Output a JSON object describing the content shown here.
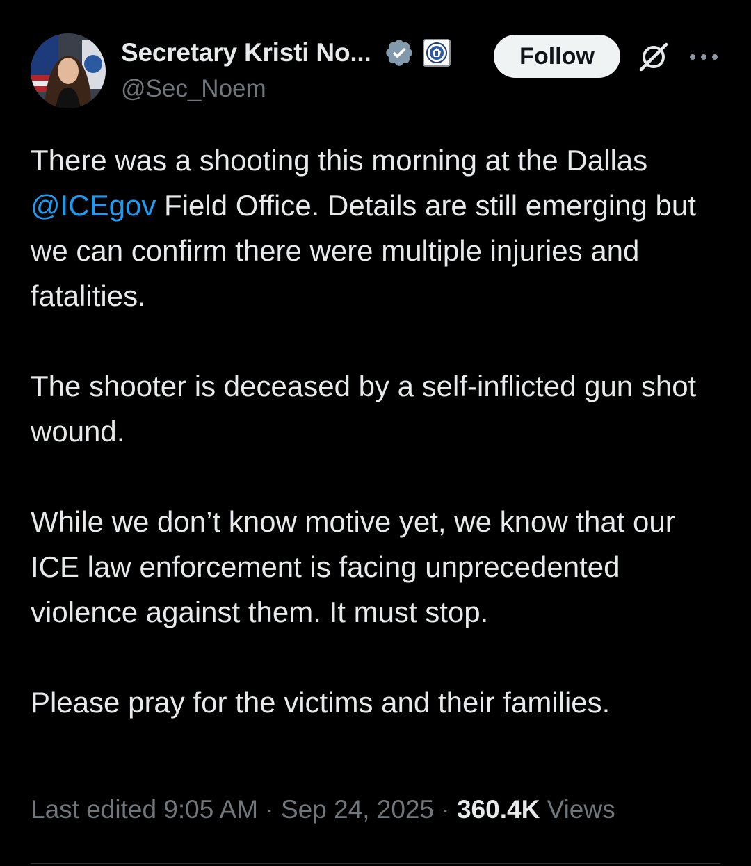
{
  "author": {
    "display_name": "Secretary Kristi No...",
    "handle": "@Sec_Noem",
    "verified_badge_color": "#829aab",
    "affiliate_badge": "dhs-seal-icon"
  },
  "actions": {
    "follow_label": "Follow",
    "grok_icon": "grok-icon",
    "more_icon": "more-icon"
  },
  "tweet": {
    "paragraphs": [
      {
        "before": "There was a shooting this morning at the Dallas ",
        "mention": "@ICEgov",
        "after": " Field Office. Details are still emerging but we can confirm there were multiple injuries and fatalities."
      },
      {
        "text": "The shooter is deceased by a self-inflicted gun shot wound."
      },
      {
        "text": "While we don’t know motive yet, we know that our ICE law enforcement is facing unprecedented violence against them. It must stop."
      },
      {
        "text": "Please pray for the victims and their families."
      }
    ]
  },
  "meta": {
    "edited_label": "Last edited 9:05 AM",
    "separator": " · ",
    "date": "Sep 24, 2025",
    "views_count": "360.4K",
    "views_label": " Views"
  },
  "colors": {
    "background": "#000000",
    "text": "#e7e9ea",
    "secondary_text": "#71767b",
    "link": "#1d9bf0",
    "follow_bg": "#eff3f4"
  }
}
